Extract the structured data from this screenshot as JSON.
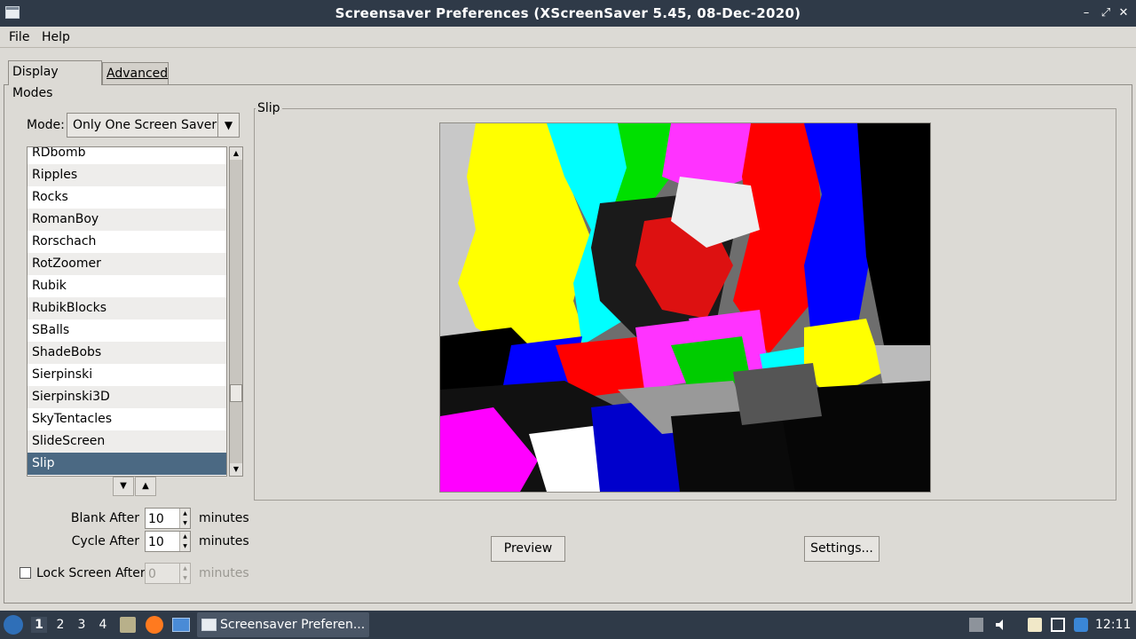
{
  "window": {
    "title": "Screensaver Preferences  (XScreenSaver 5.45, 08-Dec-2020)",
    "minimize": "–",
    "maximize": "⤢",
    "close": "✕"
  },
  "menu": {
    "file": "File",
    "help": "Help"
  },
  "tabs": [
    {
      "label": "Display Modes",
      "active": true
    },
    {
      "label": "Advanced",
      "active": false
    }
  ],
  "mode": {
    "label": "Mode:",
    "selected": "Only One Screen Saver"
  },
  "list": {
    "items": [
      "RDbomb",
      "Ripples",
      "Rocks",
      "RomanBoy",
      "Rorschach",
      "RotZoomer",
      "Rubik",
      "RubikBlocks",
      "SBalls",
      "ShadeBobs",
      "Sierpinski",
      "Sierpinski3D",
      "SkyTentacles",
      "SlideScreen",
      "Slip"
    ],
    "selected": "Slip"
  },
  "timing": {
    "blank_label": "Blank After",
    "blank_value": "10",
    "blank_unit": "minutes",
    "cycle_label": "Cycle After",
    "cycle_value": "10",
    "cycle_unit": "minutes",
    "lock_label": "Lock Screen After",
    "lock_value": "0",
    "lock_unit": "minutes",
    "lock_checked": false
  },
  "preview": {
    "frame_title": "Slip",
    "preview_button": "Preview",
    "settings_button": "Settings..."
  },
  "taskbar": {
    "workspaces": [
      "1",
      "2",
      "3",
      "4"
    ],
    "active_workspace": "1",
    "task_title": "Screensaver Preferen...",
    "clock": "12:11",
    "tray_icons": [
      "sound-icon",
      "clipboard-icon",
      "display-icon",
      "notification-icon"
    ]
  }
}
